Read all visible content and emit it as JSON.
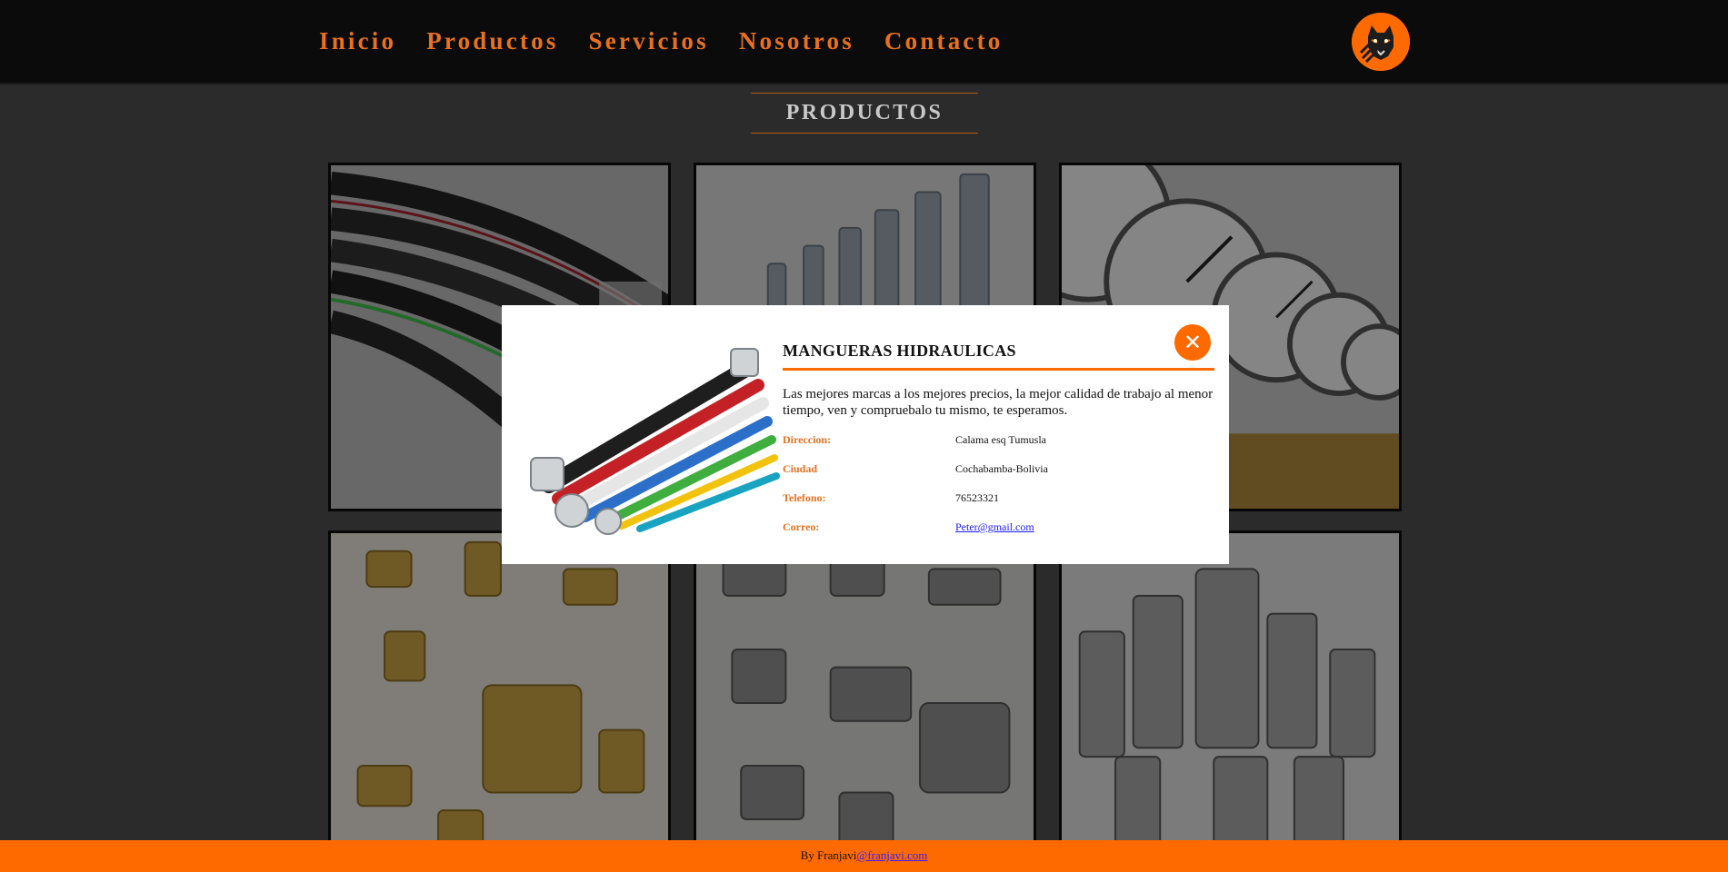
{
  "nav": {
    "items": [
      "Inicio",
      "Productos",
      "Servicios",
      "Nosotros",
      "Contacto"
    ]
  },
  "logo": {
    "icon": "tiger-logo-icon"
  },
  "section": {
    "title": "PRODUCTOS"
  },
  "products": [
    {
      "icon": "hydraulic-hoses-image"
    },
    {
      "icon": "hose-fittings-image"
    },
    {
      "icon": "pressure-gauges-image"
    },
    {
      "icon": "brass-fittings-image"
    },
    {
      "icon": "steel-fittings-image"
    },
    {
      "icon": "quick-couplers-image"
    }
  ],
  "modal": {
    "title": "MANGUERAS HIDRAULICAS",
    "description": "Las mejores marcas a los mejores precios, la mejor calidad de trabajo al menor tiempo, ven y compruebalo tu mismo, te esperamos.",
    "close_label": "✕",
    "info": [
      {
        "key": "Direccion:",
        "value": "Calama esq Tumusla"
      },
      {
        "key": "Ciudad",
        "value": "Cochabamba-Bolivia"
      },
      {
        "key": "Telefono:",
        "value": "76523321"
      },
      {
        "key": "Correo:",
        "value": "Peter@gmail.com"
      }
    ]
  },
  "footer": {
    "by": "By Franjavi",
    "link": "@franjavi.com"
  },
  "colors": {
    "accent": "#ff6a00",
    "nav_text": "#e8701f",
    "header_bg": "#0b0b0b",
    "page_bg": "#2b2b2b"
  }
}
